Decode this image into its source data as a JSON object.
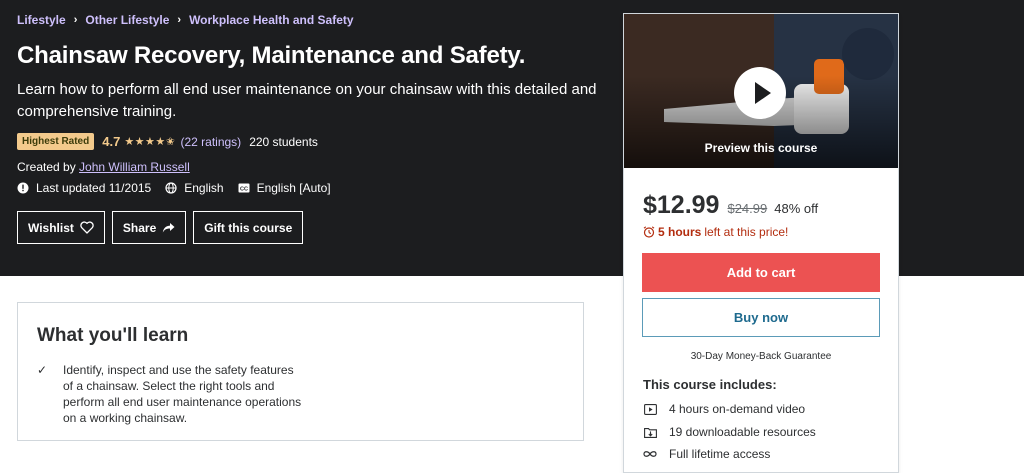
{
  "breadcrumb": [
    "Lifestyle",
    "Other Lifestyle",
    "Workplace Health and Safety"
  ],
  "course": {
    "title": "Chainsaw Recovery, Maintenance and Safety.",
    "subtitle": "Learn how to perform all end user maintenance on your chainsaw with this detailed and comprehensive training.",
    "badge": "Highest Rated",
    "rating": "4.7",
    "stars": "★★★★✬",
    "ratings_count": "(22 ratings)",
    "students": "220 students",
    "created_label": "Created by",
    "author": "John William Russell",
    "last_updated": "Last updated 11/2015",
    "language": "English",
    "captions": "English [Auto]"
  },
  "actions": {
    "wishlist": "Wishlist",
    "share": "Share",
    "gift": "Gift this course"
  },
  "learn": {
    "title": "What you'll learn",
    "items": [
      "Identify, inspect and use the safety features of a chainsaw. Select the right tools and perform all end user maintenance operations on a working chainsaw."
    ]
  },
  "card": {
    "preview_label": "Preview this course",
    "price": "$12.99",
    "original_price": "$24.99",
    "discount": "48% off",
    "time_left": "5 hours",
    "time_suffix": "left at this price!",
    "add_to_cart": "Add to cart",
    "buy_now": "Buy now",
    "guarantee": "30-Day Money-Back Guarantee",
    "includes_title": "This course includes:",
    "includes": [
      "4 hours on-demand video",
      "19 downloadable resources",
      "Full lifetime access"
    ]
  },
  "colors": {
    "hero_bg": "#1c1d1f",
    "link": "#cec0fc",
    "star": "#f3ca8c",
    "cart": "#ec5252",
    "timer": "#b32d0f"
  }
}
